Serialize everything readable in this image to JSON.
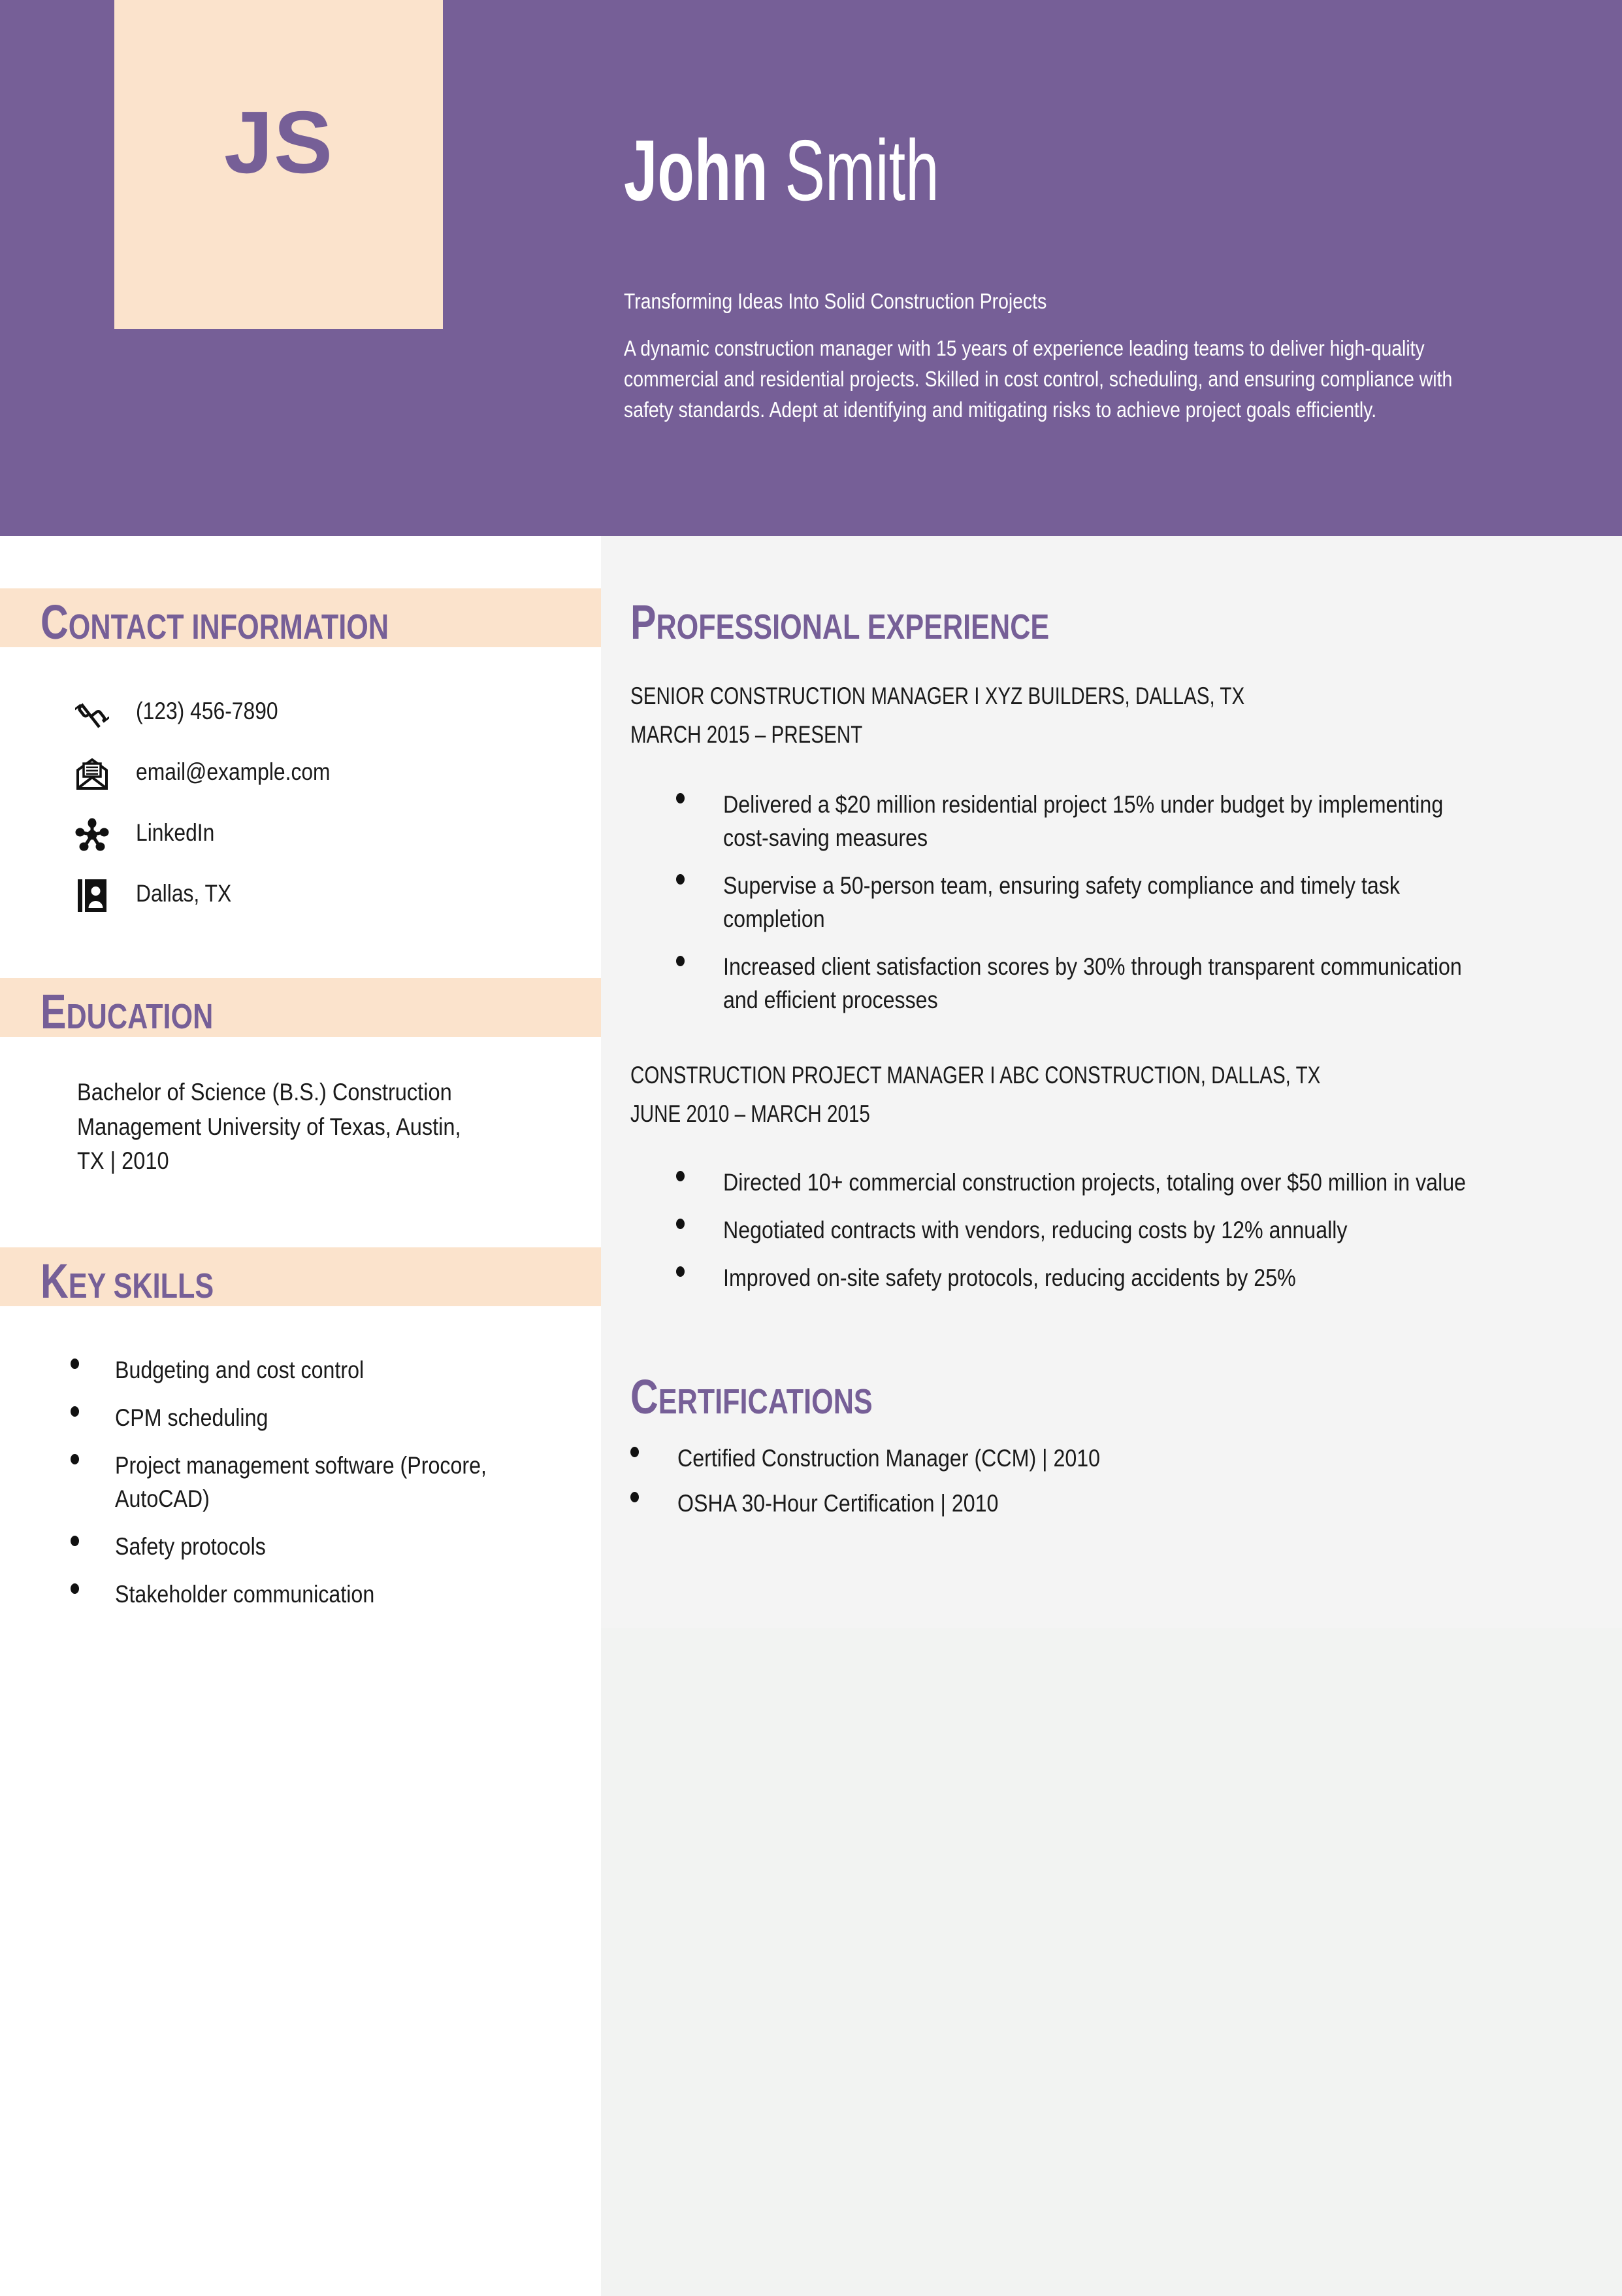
{
  "theme": {
    "purple": "#765f97",
    "peach": "#fbe3cc",
    "panel_gray": "#f4f4f4",
    "text_dark": "#1a1a1a",
    "white": "#ffffff"
  },
  "header": {
    "monogram": "JS",
    "first_name": "John",
    "last_name": "Smith",
    "tagline": "Transforming Ideas Into Solid Construction Projects",
    "summary": "A dynamic construction manager with 15 years of experience leading teams to deliver high-quality commercial and residential projects. Skilled in cost control, scheduling, and ensuring compliance with safety standards. Adept at identifying and mitigating risks to achieve project goals efficiently."
  },
  "sidebar": {
    "contact": {
      "heading_cap": "C",
      "heading_rest": "ontact information",
      "items": [
        {
          "icon": "phone-icon",
          "value": "(123) 456-7890"
        },
        {
          "icon": "envelope-icon",
          "value": "email@example.com"
        },
        {
          "icon": "network-icon",
          "value": "LinkedIn"
        },
        {
          "icon": "contact-card-icon",
          "value": "Dallas, TX"
        }
      ]
    },
    "education": {
      "heading_cap": "E",
      "heading_rest": "ducation",
      "entry": "Bachelor of Science (B.S.) Construction Management University of Texas, Austin, TX | 2010"
    },
    "key_skills": {
      "heading_cap": "K",
      "heading_rest": "ey skills",
      "items": [
        "Budgeting and cost control",
        "CPM scheduling",
        "Project management software (Procore, AutoCAD)",
        "Safety protocols",
        "Stakeholder communication"
      ]
    }
  },
  "main": {
    "experience": {
      "heading_cap": "P",
      "heading_rest": "rofessional experience",
      "jobs": [
        {
          "title": "SENIOR CONSTRUCTION MANAGER I XYZ BUILDERS, DALLAS, TX",
          "dates": "MARCH 2015 – PRESENT",
          "bullets": [
            "Delivered a $20 million residential project 15% under budget by implementing cost-saving measures",
            "Supervise a 50-person team, ensuring safety compliance and timely task completion",
            "Increased client satisfaction scores by 30% through transparent communication and efficient processes"
          ]
        },
        {
          "title": "CONSTRUCTION PROJECT MANAGER I ABC CONSTRUCTION, DALLAS, TX",
          "dates": "JUNE 2010 – MARCH 2015",
          "bullets": [
            "Directed 10+ commercial construction projects, totaling over $50 million in value",
            "Negotiated contracts with vendors, reducing costs by 12% annually",
            "Improved on-site safety protocols, reducing accidents by 25%"
          ]
        }
      ]
    },
    "certifications": {
      "heading_cap": "C",
      "heading_rest": "ertifications",
      "items": [
        "Certified Construction Manager (CCM) | 2010",
        "OSHA 30-Hour Certification | 2010"
      ]
    }
  }
}
